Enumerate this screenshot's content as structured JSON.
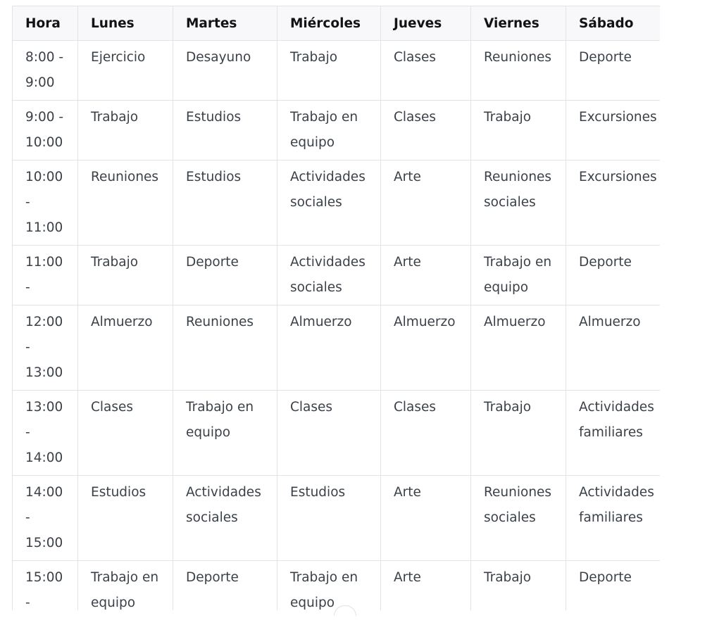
{
  "table": {
    "headers": [
      "Hora",
      "Lunes",
      "Martes",
      "Miércoles",
      "Jueves",
      "Viernes",
      "Sábado"
    ],
    "rows": [
      [
        "8:00 - 9:00",
        "Ejercicio",
        "Desayuno",
        "Trabajo",
        "Clases",
        "Reuniones",
        "Deporte"
      ],
      [
        "9:00 - 10:00",
        "Trabajo",
        "Estudios",
        "Trabajo en equipo",
        "Clases",
        "Trabajo",
        "Excursiones"
      ],
      [
        "10:00 - 11:00",
        "Reuniones",
        "Estudios",
        "Actividades sociales",
        "Arte",
        "Reuniones sociales",
        "Excursiones"
      ],
      [
        "11:00 -",
        "Trabajo",
        "Deporte",
        "Actividades sociales",
        "Arte",
        "Trabajo en equipo",
        "Deporte"
      ],
      [
        "12:00 - 13:00",
        "Almuerzo",
        "Reuniones",
        "Almuerzo",
        "Almuerzo",
        "Almuerzo",
        "Almuerzo"
      ],
      [
        "13:00 - 14:00",
        "Clases",
        "Trabajo en equipo",
        "Clases",
        "Clases",
        "Trabajo",
        "Actividades familiares"
      ],
      [
        "14:00 - 15:00",
        "Estudios",
        "Actividades sociales",
        "Estudios",
        "Arte",
        "Reuniones sociales",
        "Actividades familiares"
      ],
      [
        "15:00 -",
        "Trabajo en equipo",
        "Deporte",
        "Trabajo en equipo",
        "Arte",
        "Trabajo",
        "Deporte"
      ]
    ]
  }
}
